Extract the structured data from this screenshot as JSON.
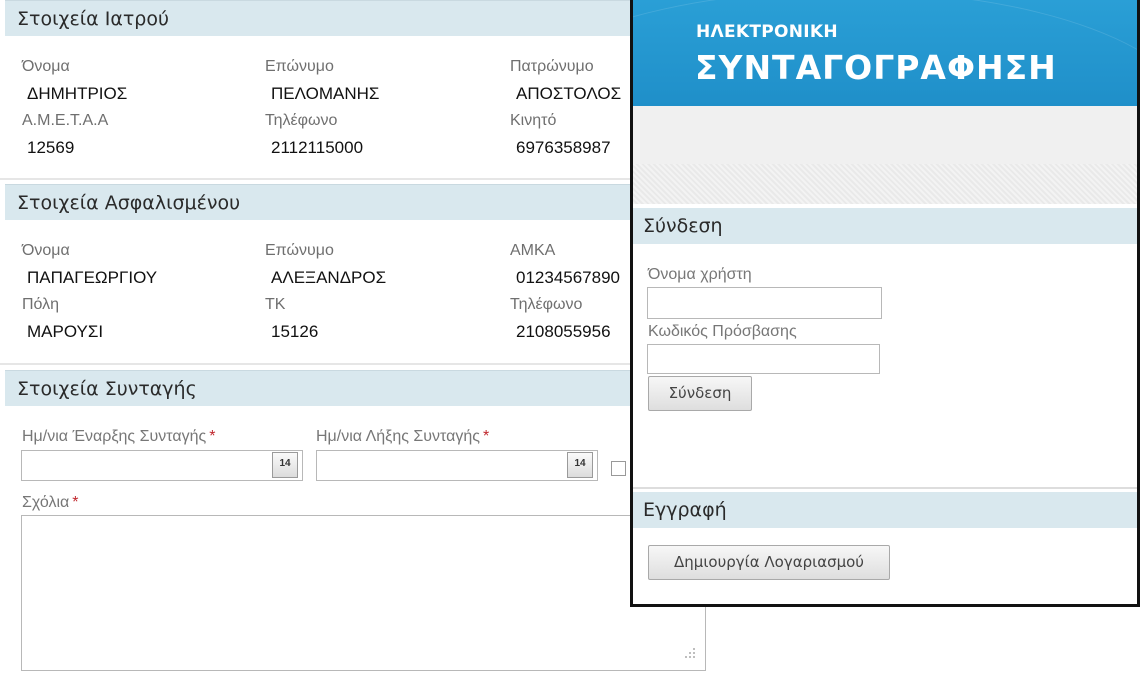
{
  "doctor": {
    "header": "Στοιχεία Ιατρού",
    "first_name_label": "Όνομα",
    "first_name": "ΔΗΜΗΤΡΙΟΣ",
    "last_name_label": "Επώνυμο",
    "last_name": "ΠΕΛΟΜΑΝΗΣ",
    "father_name_label": "Πατρώνυμο",
    "father_name": "ΑΠΟΣΤΟΛΟΣ",
    "ameta_label": "Α.Μ.Ε.Τ.Α.Α",
    "ameta": "12569",
    "phone_label": "Τηλέφωνο",
    "phone": "2112115000",
    "mobile_label": "Κινητό",
    "mobile": "6976358987"
  },
  "insured": {
    "header": "Στοιχεία Ασφαλισμένου",
    "first_name_label": "Όνομα",
    "first_name": "ΠΑΠΑΓΕΩΡΓΙΟΥ",
    "last_name_label": "Επώνυμο",
    "last_name": "ΑΛΕΞΑΝΔΡΟΣ",
    "amka_label": "ΑΜΚΑ",
    "amka": "01234567890",
    "city_label": "Πόλη",
    "city": "ΜΑΡΟΥΣΙ",
    "postcode_label": "ΤΚ",
    "postcode": "15126",
    "phone_label": "Τηλέφωνο",
    "phone": "2108055956"
  },
  "prescription": {
    "header": "Στοιχεία Συνταγής",
    "start_date_label": "Ημ/νια Έναρξης Συνταγής",
    "start_date_value": "",
    "end_date_label": "Ημ/νια Λήξης Συνταγής",
    "end_date_value": "",
    "calendar_glyph": "14",
    "comments_label": "Σχόλια",
    "comments_value": "",
    "required_mark": "*"
  },
  "login_panel": {
    "banner_line1": "ΗΛΕΚΤΡΟΝΙΚΗ",
    "banner_line2": "ΣΥΝΤΑΓΟΓΡΑΦΗΣΗ",
    "login_header": "Σύνδεση",
    "username_label": "Όνομα χρήστη",
    "username_value": "",
    "password_label": "Κωδικός Πρόσβασης",
    "password_value": "",
    "login_button": "Σύνδεση",
    "register_header": "Εγγραφή",
    "create_account_button": "Δημιουργία Λογαριασμού"
  },
  "colors": {
    "section_header_bg": "#d9e8ee",
    "banner_blue": "#2a9fd6",
    "required_red": "#c0262c"
  }
}
